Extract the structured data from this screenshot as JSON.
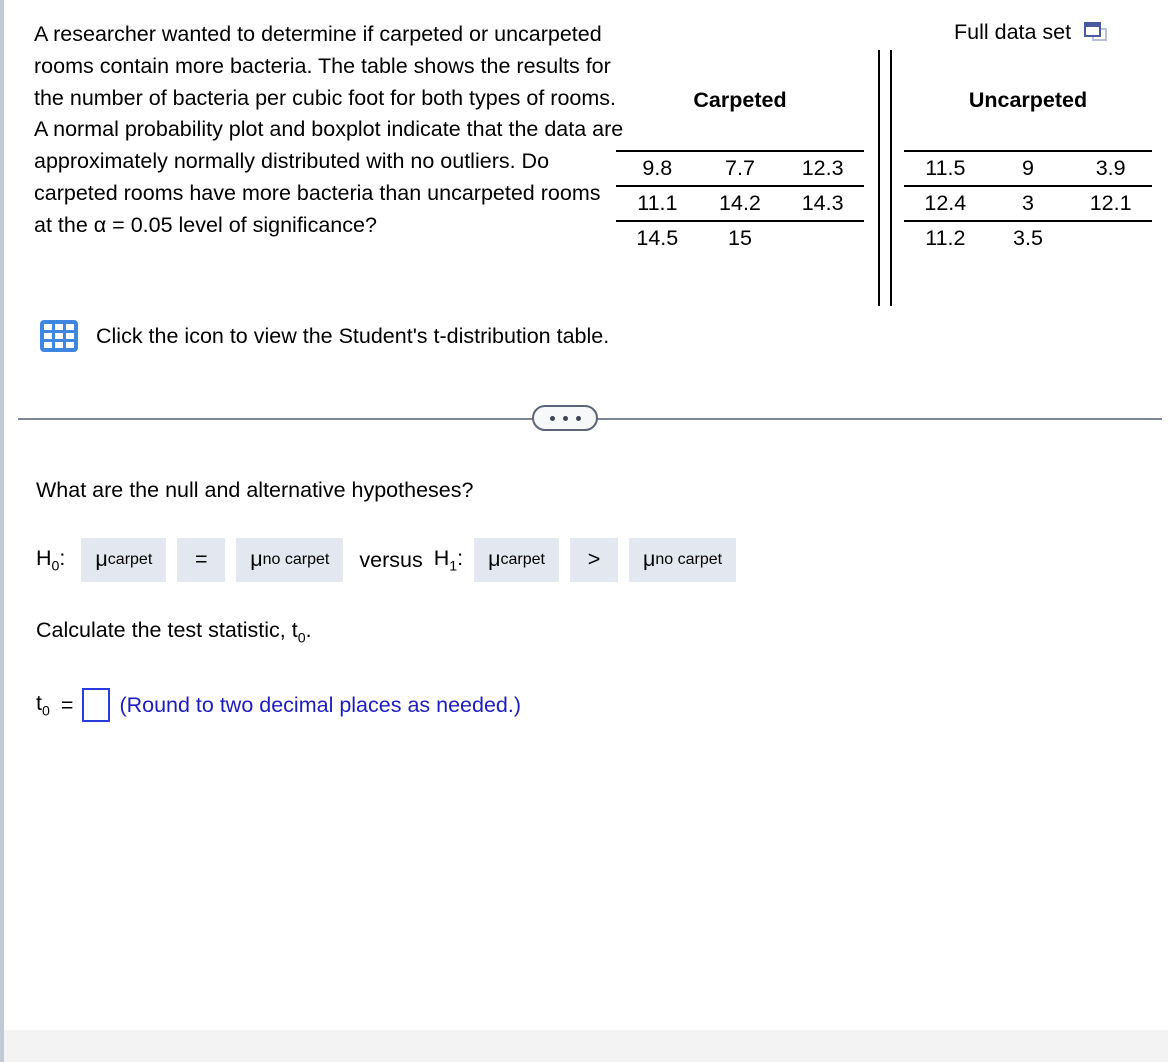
{
  "problem": {
    "statement": "A researcher wanted to determine if carpeted or uncarpeted rooms contain more bacteria. The table shows the results for the number of bacteria per cubic foot for both types of rooms. A normal probability plot and boxplot indicate that the data are approximately normally distributed with no outliers. Do carpeted rooms have more bacteria than uncarpeted rooms at the α = 0.05 level of significance?",
    "ttable_link_text": "Click the icon to view the Student's t-distribution table.",
    "ttable_icon": "grid-table-icon"
  },
  "full_data_set": {
    "label": "Full data set",
    "icon": "stacked-windows-icon"
  },
  "data_table": {
    "groups": [
      {
        "header": "Carpeted",
        "rows": [
          [
            "9.8",
            "7.7",
            "12.3"
          ],
          [
            "11.1",
            "14.2",
            "14.3"
          ],
          [
            "14.5",
            "15",
            ""
          ]
        ]
      },
      {
        "header": "Uncarpeted",
        "rows": [
          [
            "11.5",
            "9",
            "3.9"
          ],
          [
            "12.4",
            "3",
            "12.1"
          ],
          [
            "11.2",
            "3.5",
            ""
          ]
        ]
      }
    ]
  },
  "divider": {
    "ellipsis": "• • •"
  },
  "questions": {
    "hypotheses_prompt": "What are the null and alternative hypotheses?",
    "h0_label": "H",
    "h0_sub": "0",
    "h0_colon": ":",
    "h0_left_value": "μ",
    "h0_left_sub": "carpet",
    "h0_operator": "=",
    "h0_right_value": "μ",
    "h0_right_sub": "no carpet",
    "versus_text": "versus",
    "h1_label": "H",
    "h1_sub": "1",
    "h1_colon": ":",
    "h1_left_value": "μ",
    "h1_left_sub": "carpet",
    "h1_operator": ">",
    "h1_right_value": "μ",
    "h1_right_sub": "no carpet",
    "teststat_prompt_a": "Calculate the test statistic, t",
    "teststat_prompt_sub": "0",
    "teststat_prompt_b": ".",
    "answer_label": "t",
    "answer_label_sub": "0",
    "answer_equals": "=",
    "answer_value": "",
    "answer_hint": "(Round to two decimal places as needed.)"
  },
  "colors": {
    "dropbox_background": "#e3e8f0",
    "hint_text": "#1d1dbf",
    "input_border": "#2a3be0",
    "divider": "#7d8597",
    "page_border": "#c2c9d6",
    "grid_icon": "#3f86e0",
    "window_icon": "#4b5aa0",
    "footer": "#f3f3f3"
  }
}
